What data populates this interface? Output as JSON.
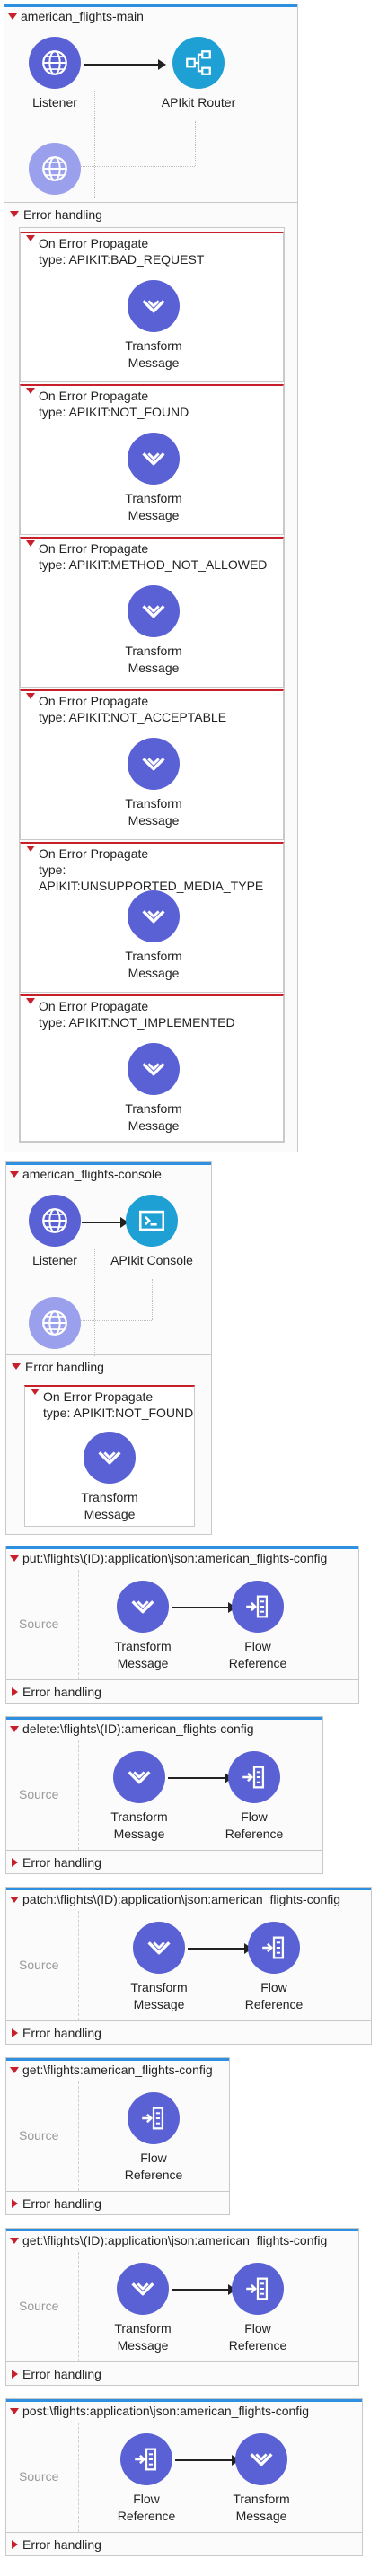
{
  "flows": {
    "main": {
      "title": "american_flights-main",
      "listener": "Listener",
      "router": "APIkit Router",
      "error_handling": "Error handling",
      "handlers": [
        {
          "title": "On Error Propagate",
          "type": "type: APIKIT:BAD_REQUEST",
          "component": "Transform Message"
        },
        {
          "title": "On Error Propagate",
          "type": "type: APIKIT:NOT_FOUND",
          "component": "Transform Message"
        },
        {
          "title": "On Error Propagate",
          "type": "type: APIKIT:METHOD_NOT_ALLOWED",
          "component": "Transform Message"
        },
        {
          "title": "On Error Propagate",
          "type": "type: APIKIT:NOT_ACCEPTABLE",
          "component": "Transform Message"
        },
        {
          "title": "On Error Propagate",
          "type": "type: APIKIT:UNSUPPORTED_MEDIA_TYPE",
          "component": "Transform Message"
        },
        {
          "title": "On Error Propagate",
          "type": "type: APIKIT:NOT_IMPLEMENTED",
          "component": "Transform Message"
        }
      ]
    },
    "console": {
      "title": "american_flights-console",
      "listener": "Listener",
      "apikit_console": "APIkit Console",
      "error_handling": "Error handling",
      "handler": {
        "title": "On Error Propagate",
        "type": "type: APIKIT:NOT_FOUND",
        "component": "Transform Message"
      }
    },
    "put": {
      "title": "put:\\flights\\(ID):application\\json:american_flights-config",
      "source": "Source",
      "first": "Transform Message",
      "second": "Flow Reference",
      "error_handling": "Error handling"
    },
    "delete": {
      "title": "delete:\\flights\\(ID):american_flights-config",
      "source": "Source",
      "first": "Transform Message",
      "second": "Flow Reference",
      "error_handling": "Error handling"
    },
    "patch": {
      "title": "patch:\\flights\\(ID):application\\json:american_flights-config",
      "source": "Source",
      "first": "Transform Message",
      "second": "Flow Reference",
      "error_handling": "Error handling"
    },
    "get_all": {
      "title": "get:\\flights:american_flights-config",
      "source": "Source",
      "first": "Flow Reference",
      "error_handling": "Error handling"
    },
    "get_id": {
      "title": "get:\\flights\\(ID):application\\json:american_flights-config",
      "source": "Source",
      "first": "Transform Message",
      "second": "Flow Reference",
      "error_handling": "Error handling"
    },
    "post": {
      "title": "post:\\flights:application\\json:american_flights-config",
      "source": "Source",
      "first": "Flow Reference",
      "second": "Transform Message",
      "error_handling": "Error handling"
    }
  },
  "colors": {
    "accent": "#2f8fe0",
    "error": "#c8202a",
    "transform": "#5a61d4",
    "router": "#1ea0d5"
  }
}
